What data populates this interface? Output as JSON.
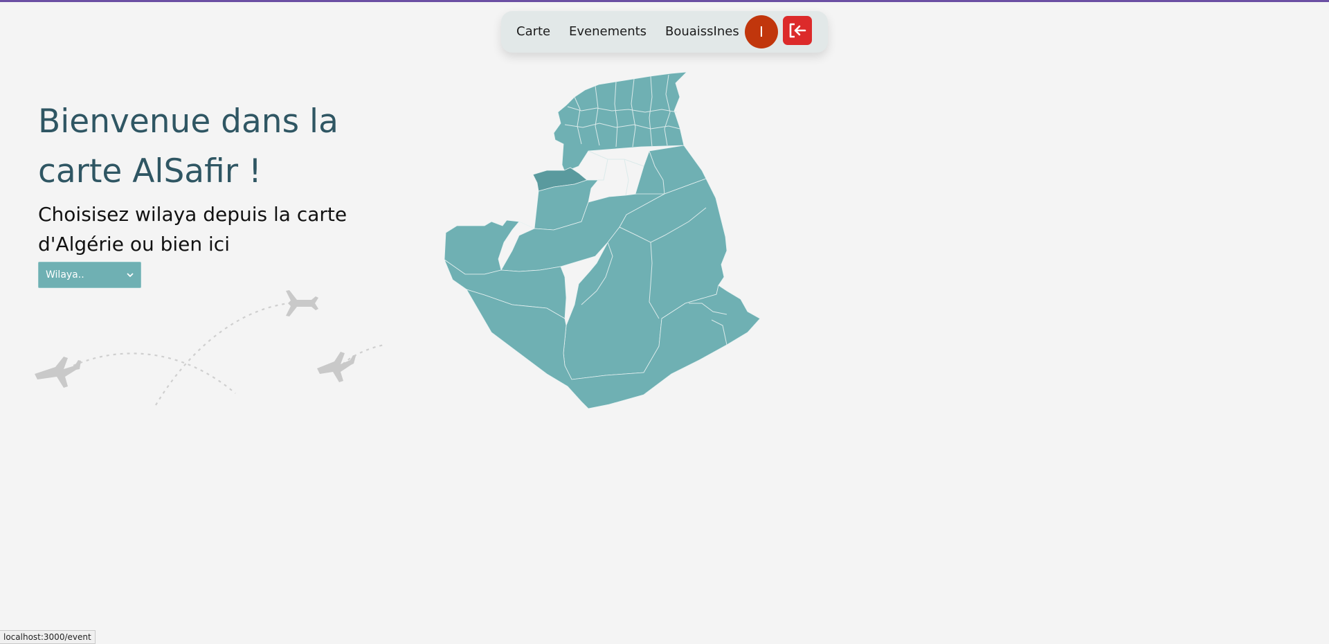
{
  "nav": {
    "links": [
      "Carte",
      "Evenements",
      "BouaissInes"
    ],
    "avatar_initial": "I",
    "logout_icon": "logout-arrow-icon"
  },
  "hero": {
    "title": "Bienvenue dans la carte AlSafir !",
    "subtitle": "Choisisez wilaya depuis la carte d'Algérie ou bien ici"
  },
  "select": {
    "value": "Wilaya.."
  },
  "status_bar": {
    "url": "localhost:3000/event"
  },
  "colors": {
    "accent": "#6fb0b3",
    "title": "#2f5663",
    "avatar": "#c1360c",
    "logout": "#dc2a2a",
    "top_border": "#6b4fa3"
  }
}
